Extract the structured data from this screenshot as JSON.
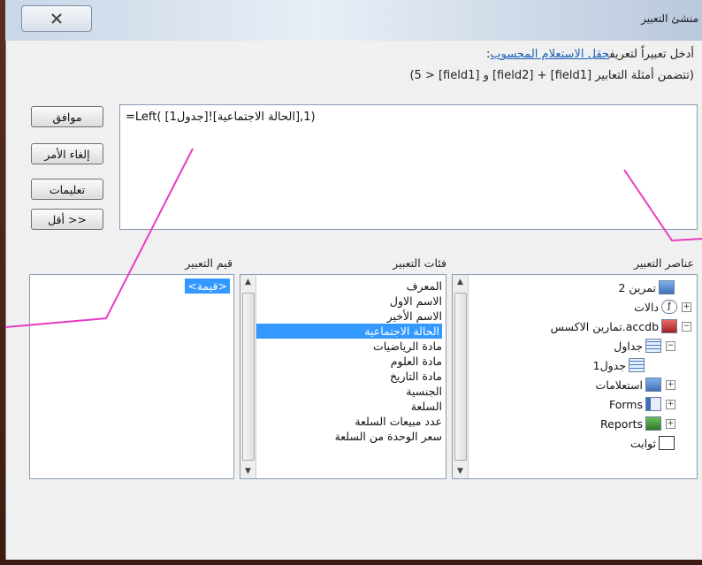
{
  "window": {
    "title": "منشئ التعبير"
  },
  "instructions": {
    "prefix": "أدخل تعبيراً لتعريف",
    "link": "حقل الاستعلام المحسوب",
    "suffix": ":",
    "examples": "(تتضمن أمثلة التعابير [field1] + [field2] و [field1] < 5)"
  },
  "expression": {
    "value": "=Left( [جدول1]![الحالة الاجتماعية],1)"
  },
  "buttons": {
    "ok": "موافق",
    "cancel": "إلغاء الأمر",
    "help": "تعليمات",
    "less": "<< أقل"
  },
  "labels": {
    "elements": "عناصر التعبير",
    "categories": "فئات التعبير",
    "values": "قيم التعبير"
  },
  "elements_tree": [
    {
      "label": "تمرين 2",
      "icon": "query-icon"
    },
    {
      "label": "دالات",
      "icon": "function-icon"
    },
    {
      "label": "تمارين الاكسس.accdb",
      "icon": "database-icon"
    },
    {
      "label": "جداول",
      "icon": "table-icon"
    },
    {
      "label": "جدول1",
      "icon": "table-icon"
    },
    {
      "label": "استعلامات",
      "icon": "query-icon"
    },
    {
      "label": "Forms",
      "icon": "form-icon"
    },
    {
      "label": "Reports",
      "icon": "report-icon"
    },
    {
      "label": "ثوابت",
      "icon": "constant-icon"
    }
  ],
  "categories": [
    "المعرف",
    "الاسم الاول",
    "الاسم الأخير",
    "الحالة الاجتماعية",
    "مادة الرياضيات",
    "مادة العلوم",
    "مادة التاريخ",
    "الجنسية",
    "السلعة",
    "عدد مبيعات السلعة",
    "سعر الوحدة من السلعة"
  ],
  "selected_category_index": 3,
  "values": [
    "<قيمة>"
  ],
  "colors": {
    "selection": "#3399ff",
    "callout": "#e83cc0",
    "link": "#1b5fb8"
  }
}
